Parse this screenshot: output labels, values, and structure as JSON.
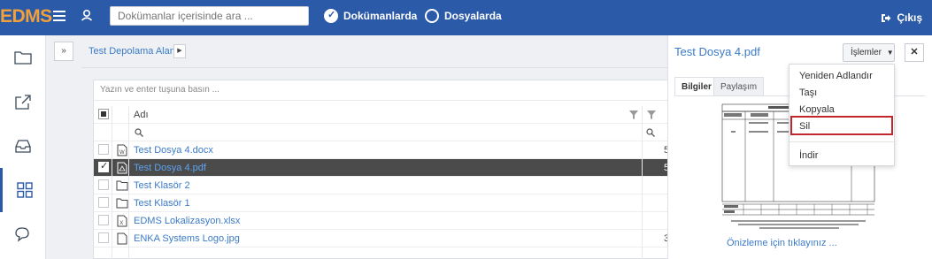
{
  "app": {
    "logo": "EDMS"
  },
  "header": {
    "search_placeholder": "Dokümanlar içerisinde ara ...",
    "scope_documents": "Dokümanlarda",
    "scope_files": "Dosyalarda",
    "logout": "Çıkış"
  },
  "breadcrumb": {
    "root": "Test Depolama Alanı"
  },
  "table": {
    "filter_placeholder": "Yazın ve enter tuşuna basın ...",
    "column_name": "Adı",
    "rows": [
      {
        "name": "Test Dosya 4.docx",
        "type": "word",
        "selected": false,
        "extra": "5"
      },
      {
        "name": "Test Dosya 4.pdf",
        "type": "pdf",
        "selected": true,
        "extra": "5"
      },
      {
        "name": "Test Klasör 2",
        "type": "folder",
        "selected": false,
        "extra": ""
      },
      {
        "name": "Test Klasör 1",
        "type": "folder",
        "selected": false,
        "extra": ""
      },
      {
        "name": "EDMS Lokalizasyon.xlsx",
        "type": "excel",
        "selected": false,
        "extra": ""
      },
      {
        "name": "ENKA Systems Logo.jpg",
        "type": "image",
        "selected": false,
        "extra": "3"
      }
    ]
  },
  "detail": {
    "title": "Test Dosya 4.pdf",
    "actions_label": "İşlemler",
    "close_label": "✕",
    "tabs": [
      "Bilgiler",
      "Paylaşım"
    ],
    "preview_link": "Önizleme için tıklayınız ..."
  },
  "actions_menu": {
    "items": [
      "Yeniden Adlandır",
      "Taşı",
      "Kopyala",
      "Sil",
      "İndir"
    ],
    "highlighted": "Sil"
  },
  "colors": {
    "topbar": "#2b5aa8",
    "logo": "#f0a13b",
    "link": "#3b7bc8",
    "highlight": "#c0262c",
    "selected_row": "#4b4b4b"
  }
}
